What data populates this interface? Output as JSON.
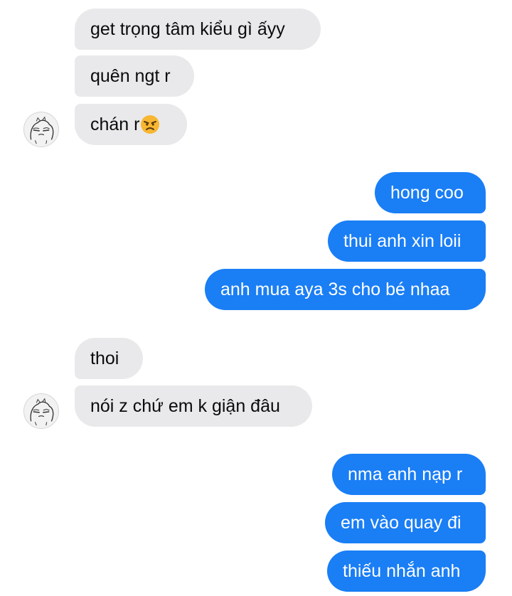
{
  "conversation": {
    "group1": {
      "msg1": "get trọng tâm kiểu gì ấyy",
      "msg2": "quên ngt r",
      "msg3_text": "chán r",
      "msg3_emoji": "angry-face-emoji"
    },
    "group2": {
      "msg1": "hong coo",
      "msg2": "thui anh xin loii",
      "msg3": "anh mua aya 3s cho bé nhaa"
    },
    "group3": {
      "msg1": "thoi",
      "msg2": "nói z chứ em k giận đâu"
    },
    "group4": {
      "msg1": "nma anh nạp r",
      "msg2": "em vào quay đi",
      "msg3": "thiếu nhắn anh"
    }
  },
  "colors": {
    "incoming_bubble": "#e9e9eb",
    "outgoing_bubble": "#1a7ef5",
    "outgoing_text": "#ffffff",
    "incoming_text": "#0b0b0b"
  }
}
